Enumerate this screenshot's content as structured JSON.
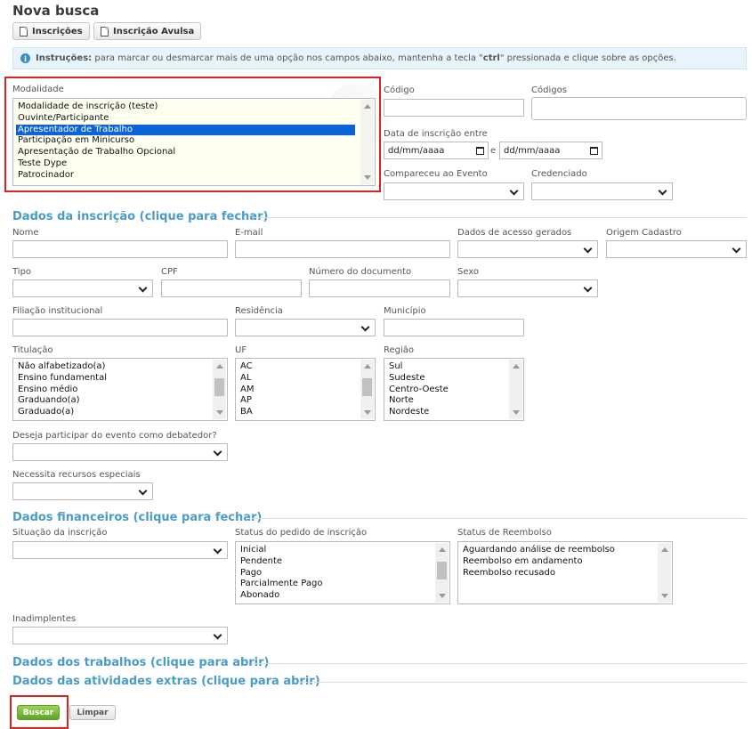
{
  "page": {
    "title": "Nova busca"
  },
  "toolbar": {
    "inscricoes": "Inscrições",
    "avulsa": "Inscrição Avulsa"
  },
  "instructions": {
    "icon": "info-icon",
    "bold": "Instruções:",
    "text_before": "para marcar ou desmarcar mais de uma opção nos campos abaixo, mantenha a tecla \"",
    "key": "ctrl",
    "text_after": "\" pressionada e clique sobre as opções."
  },
  "filters": {
    "modalidade": {
      "label": "Modalidade",
      "options": [
        "Modalidade de inscrição (teste)",
        "Ouvinte/Participante",
        "Apresentador de Trabalho",
        "Participação em Minicurso",
        "Apresentação de Trabalho Opcional",
        "Teste Dype",
        "Patrocinador"
      ],
      "selected": "Apresentador de Trabalho"
    },
    "codigo": {
      "label": "Código"
    },
    "codigos": {
      "label": "Códigos"
    },
    "data": {
      "label": "Data de inscrição entre",
      "placeholder": "dd/mm/aaaa",
      "sep": "e"
    },
    "compareceu": {
      "label": "Compareceu ao Evento"
    },
    "credenciado": {
      "label": "Credenciado"
    }
  },
  "sections": {
    "inscricao": "Dados da inscrição (clique para fechar)",
    "financeiros": "Dados financeiros (clique para fechar)",
    "trabalhos": "Dados dos trabalhos (clique para abrir)",
    "atividades": "Dados das atividades extras (clique para abrir)"
  },
  "inscricao": {
    "nome": "Nome",
    "email": "E-mail",
    "acesso": "Dados de acesso gerados",
    "origem": "Origem Cadastro",
    "tipo": "Tipo",
    "cpf": "CPF",
    "documento": "Número do documento",
    "sexo": "Sexo",
    "filiacao": "Filiação institucional",
    "residencia": "Residência",
    "municipio": "Município",
    "titulacao": {
      "label": "Titulação",
      "options": [
        "Não alfabetizado(a)",
        "Ensino fundamental",
        "Ensino médio",
        "Graduando(a)",
        "Graduado(a)"
      ]
    },
    "uf": {
      "label": "UF",
      "options": [
        "AC",
        "AL",
        "AM",
        "AP",
        "BA"
      ]
    },
    "regiao": {
      "label": "Região",
      "options": [
        "Sul",
        "Sudeste",
        "Centro-Oeste",
        "Norte",
        "Nordeste"
      ]
    },
    "debatedor": "Deseja participar do evento como debatedor?",
    "recursos": "Necessita recursos especiais"
  },
  "financeiro": {
    "situacao": "Situação da inscrição",
    "status_pedido": {
      "label": "Status do pedido de inscrição",
      "options": [
        "Inicial",
        "Pendente",
        "Pago",
        "Parcialmente Pago",
        "Abonado"
      ]
    },
    "status_reembolso": {
      "label": "Status de Reembolso",
      "options": [
        "Aguardando análise de reembolso",
        "Reembolso em andamento",
        "Reembolso recusado"
      ]
    },
    "inadimplentes": "Inadimplentes"
  },
  "actions": {
    "buscar": "Buscar",
    "limpar": "Limpar"
  },
  "colors": {
    "accent": "#4a9cc7",
    "highlight_border": "#d22222",
    "selected_option": "#0a64d7",
    "button_green": "#5fa328"
  }
}
